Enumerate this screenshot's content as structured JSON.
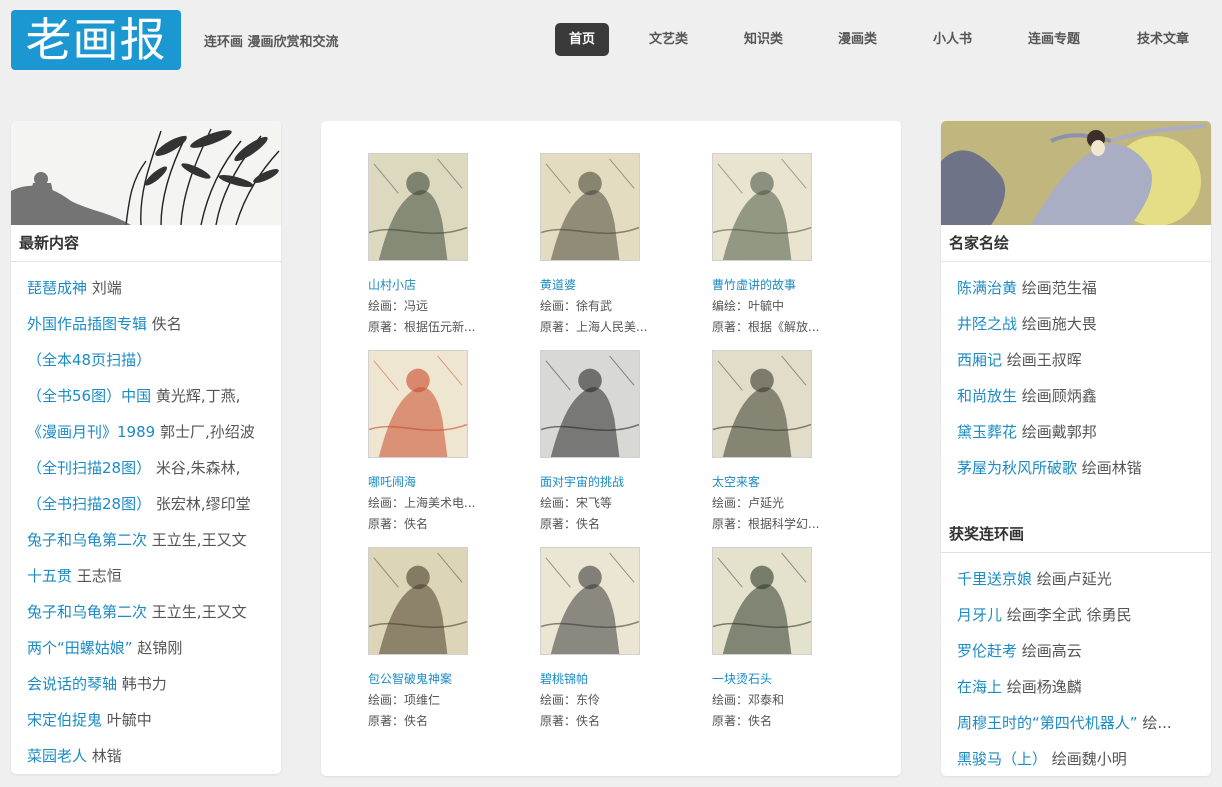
{
  "header": {
    "logo": "老画报",
    "tagline": "连环画 漫画欣赏和交流",
    "nav": [
      "首页",
      "文艺类",
      "知识类",
      "漫画类",
      "小人书",
      "连画专题",
      "技术文章"
    ]
  },
  "left": {
    "title": "最新内容",
    "items": [
      {
        "title": "琵琶成神",
        "author": "刘端"
      },
      {
        "title": "外国作品插图专辑",
        "author": "佚名"
      },
      {
        "title": "（全本48页扫描）",
        "author": ""
      },
      {
        "title": "（全书56图）中国",
        "author": "黄光辉,丁燕,"
      },
      {
        "title": "《漫画月刊》1989",
        "author": "郭士厂,孙绍波"
      },
      {
        "title": "（全刊扫描28图）",
        "author": "米谷,朱森林,"
      },
      {
        "title": "（全书扫描28图）",
        "author": "张宏林,缪印堂"
      },
      {
        "title": "兔子和乌龟第二次",
        "author": "王立生,王又文"
      },
      {
        "title": "十五贯",
        "author": "王志恒"
      },
      {
        "title": "兔子和乌龟第二次",
        "author": "王立生,王又文"
      },
      {
        "title": "两个“田螺姑娘”",
        "author": "赵锦刚"
      },
      {
        "title": "会说话的琴轴",
        "author": "韩书力"
      },
      {
        "title": "宋定伯捉鬼",
        "author": "叶毓中"
      },
      {
        "title": "菜园老人",
        "author": "林锴"
      }
    ]
  },
  "books": [
    {
      "title": "山村小店",
      "line1": "绘画：冯远",
      "line2": "原著：根据伍元新..."
    },
    {
      "title": "黄道婆",
      "line1": "绘画：徐有武",
      "line2": "原著：上海人民美..."
    },
    {
      "title": "曹竹虚讲的故事",
      "line1": "编绘：叶毓中",
      "line2": "原著：根据《解放..."
    },
    {
      "title": "哪吒闹海",
      "line1": "绘画：上海美术电...",
      "line2": "原著：佚名"
    },
    {
      "title": "面对宇宙的挑战",
      "line1": "绘画：宋飞等",
      "line2": "原著：佚名"
    },
    {
      "title": "太空来客",
      "line1": "绘画：卢延光",
      "line2": "原著：根据科学幻..."
    },
    {
      "title": "包公智破鬼神案",
      "line1": "绘画：项维仁",
      "line2": "原著：佚名"
    },
    {
      "title": "碧桃锦帕",
      "line1": "绘画：东伶",
      "line2": "原著：佚名"
    },
    {
      "title": "一块烫石头",
      "line1": "绘画：邓泰和",
      "line2": "原著：佚名"
    }
  ],
  "right": {
    "famous_title": "名家名绘",
    "famous": [
      {
        "title": "陈满治黄",
        "author": "绘画范生福"
      },
      {
        "title": "井陉之战",
        "author": "绘画施大畏"
      },
      {
        "title": "西厢记",
        "author": "绘画王叔晖"
      },
      {
        "title": "和尚放生",
        "author": "绘画顾炳鑫"
      },
      {
        "title": "黛玉葬花",
        "author": "绘画戴郭邦"
      },
      {
        "title": "茅屋为秋风所破歌",
        "author": "绘画林锴"
      }
    ],
    "award_title": "获奖连环画",
    "award": [
      {
        "title": "千里送京娘",
        "author": "绘画卢延光"
      },
      {
        "title": "月牙儿",
        "author": "绘画李全武 徐勇民"
      },
      {
        "title": "罗伦赶考",
        "author": "绘画高云"
      },
      {
        "title": "在海上",
        "author": "绘画杨逸麟"
      },
      {
        "title": "周穆王时的“第四代机器人”",
        "author": "绘..."
      },
      {
        "title": "黑骏马（上）",
        "author": "绘画魏小明"
      }
    ]
  },
  "colors": {
    "accent": "#1b97d1",
    "link": "#1b8bc3",
    "nav_active": "#3a3a3a"
  }
}
